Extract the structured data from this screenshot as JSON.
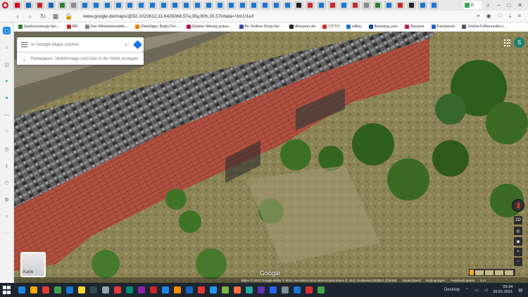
{
  "browser": {
    "active_tab_label": "G",
    "url": "www.google.de/maps/@52.1022612,11.6428368,57a,35y,90h,35.57t/data=!3m1!1e3",
    "tab_colors": [
      "#d0021b",
      "#1565c0",
      "#c62828",
      "#1565c0",
      "#2e7d32",
      "#8a8a8a",
      "#1976d2",
      "#1976d2",
      "#1976d2",
      "#1976d2",
      "#1976d2",
      "#1976d2",
      "#1976d2",
      "#1976d2",
      "#1976d2",
      "#1976d2",
      "#1976d2",
      "#1976d2",
      "#1976d2",
      "#1976d2",
      "#1976d2",
      "#1976d2",
      "#1976d2",
      "#1976d2",
      "#1976d2",
      "#222",
      "#c62828",
      "#1976d2",
      "#c62828",
      "#1976d2",
      "#c62828",
      "#888",
      "#2e7d32",
      "#1976d2",
      "#c62828",
      "#222",
      "#1976d2",
      "#1976d2"
    ]
  },
  "bookmarks": [
    {
      "label": "Gartenzwerge bei...",
      "color": "#2e7d32"
    },
    {
      "label": "RP",
      "color": "#c62828"
    },
    {
      "label": "Der Wirtelsesenblo...",
      "color": "#888"
    },
    {
      "label": "Dekofigur Baby Fin...",
      "color": "#f57c00"
    },
    {
      "label": "Sabine Wenig präse...",
      "color": "#ad1457"
    },
    {
      "label": "Ihr Online-Shop für...",
      "color": "#3949ab"
    },
    {
      "label": "Amazon.de",
      "color": "#222"
    },
    {
      "label": "OTTO",
      "color": "#d32f2f"
    },
    {
      "label": "eBay",
      "color": "#1976d2"
    },
    {
      "label": "Booking.com",
      "color": "#0d47a1"
    },
    {
      "label": "Bonprix",
      "color": "#c2185b"
    },
    {
      "label": "Facebook",
      "color": "#1565c0"
    },
    {
      "label": "OnlineTvRecorder.c...",
      "color": "#455a64"
    }
  ],
  "maps": {
    "search_placeholder": "In Google Maps suchen",
    "route_text": "Reisedauer, Verkehrslage und Orte in der Nähe anzeigen",
    "avatar_letter": "S",
    "layer_label": "Karte",
    "google_logo": "Google",
    "zoom_2d": "2D",
    "attribution": "Bilder © 2021 Google,Bilder © 2021 AeroWest,GeoContent,Kartendaten © 2021 GeoBasis-DE/BKG (©2009)",
    "country": "Deutschland",
    "terms": "Bedingungen",
    "feedback": "Feedback geben",
    "scale": "5 m"
  },
  "taskbar": {
    "desktop_label": "Desktop",
    "time": "09:34",
    "date": "26.01.2021",
    "app_colors": [
      "#1e88e5",
      "#f6a600",
      "#e53935",
      "#43a047",
      "#1976d2",
      "#fdd835",
      "#37474f",
      "#90a4ae",
      "#e53935",
      "#00897b",
      "#8e24aa",
      "#c62828",
      "#1e88e5",
      "#fb8c00",
      "#1565c0",
      "#e53935",
      "#2196f3",
      "#7cb342",
      "#ff7043",
      "#26a69a",
      "#5e35b1",
      "#2962ff",
      "#78909c",
      "#1976d2",
      "#d32f2f",
      "#43a047"
    ]
  }
}
